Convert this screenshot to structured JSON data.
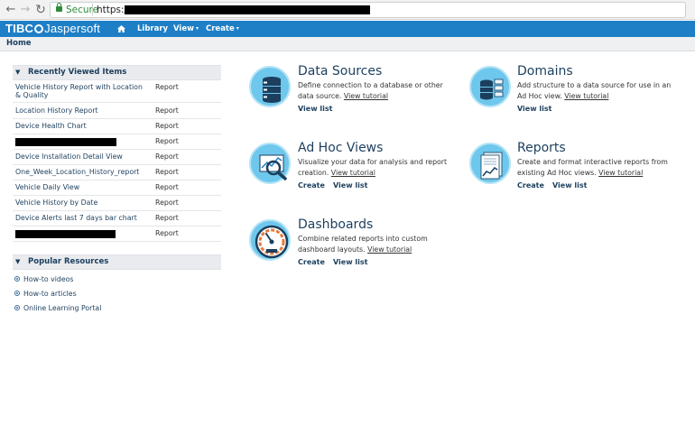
{
  "browser": {
    "secure_label": "Secure",
    "url_prefix": "https://"
  },
  "header": {
    "logo_brand": "TIBC",
    "logo_product": "Jaspersoft",
    "menu_library": "Library",
    "menu_view": "View",
    "menu_create": "Create",
    "caret": "▾"
  },
  "breadcrumb": {
    "home": "Home"
  },
  "recent": {
    "title": "Recently Viewed Items",
    "items": [
      {
        "name": "Vehicle History Report with Location & Quality",
        "type": "Report"
      },
      {
        "name": "Location History Report",
        "type": "Report"
      },
      {
        "name": "Device Health Chart",
        "type": "Report"
      },
      {
        "name": "",
        "type": "Report"
      },
      {
        "name": "Device Installation Detail View",
        "type": "Report"
      },
      {
        "name": "One_Week_Location_History_report",
        "type": "Report"
      },
      {
        "name": "Vehicle Daily View",
        "type": "Report"
      },
      {
        "name": "Vehicle History by Date",
        "type": "Report"
      },
      {
        "name": "Device Alerts last 7 days bar chart",
        "type": "Report"
      },
      {
        "name": "",
        "type": "Report"
      }
    ]
  },
  "popular": {
    "title": "Popular Resources",
    "links": [
      "How-to videos",
      "How-to articles",
      "Online Learning Portal"
    ]
  },
  "tiles": {
    "data_sources": {
      "title": "Data Sources",
      "desc": "Define connection to a database or other data source.",
      "tutorial": "View tutorial",
      "view_list": "View list"
    },
    "domains": {
      "title": "Domains",
      "desc": "Add structure to a data source for use in an Ad Hoc view.",
      "tutorial": "View tutorial",
      "view_list": "View list"
    },
    "ad_hoc": {
      "title": "Ad Hoc Views",
      "desc": "Visualize your data for analysis and report creation.",
      "tutorial": "View tutorial",
      "create": "Create",
      "view_list": "View list"
    },
    "reports": {
      "title": "Reports",
      "desc": "Create and format interactive reports from existing Ad Hoc views.",
      "tutorial": "View tutorial",
      "create": "Create",
      "view_list": "View list"
    },
    "dashboards": {
      "title": "Dashboards",
      "desc": "Combine related reports into custom dashboard layouts.",
      "tutorial": "View tutorial",
      "create": "Create",
      "view_list": "View list"
    }
  },
  "colors": {
    "header_blue": "#1e7fc6",
    "link_navy": "#1c3f5e",
    "icon_cyan": "#6ec7ec"
  }
}
